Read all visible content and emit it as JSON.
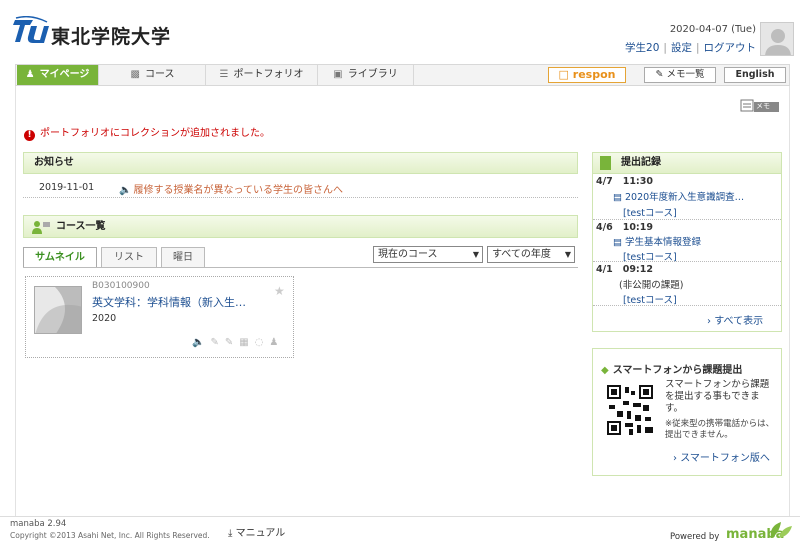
{
  "header": {
    "university_name": "東北学院大学",
    "date": "2020-04-07 (Tue)",
    "user": "学生20",
    "settings": "設定",
    "logout": "ログアウト",
    "separator": "|"
  },
  "nav": {
    "tabs": [
      {
        "label": "マイページ",
        "icon": "person-icon",
        "active": true
      },
      {
        "label": "コース",
        "icon": "class-icon"
      },
      {
        "label": "ポートフォリオ",
        "icon": "portfolio-icon"
      },
      {
        "label": "ライブラリ",
        "icon": "library-icon"
      }
    ],
    "respon": "respon",
    "memo_list": "メモ一覧",
    "english": "English"
  },
  "memo_label": "メモ",
  "alert": "ポートフォリオにコレクションが追加されました。",
  "news": {
    "heading": "お知らせ",
    "items": [
      {
        "date": "2019-11-01",
        "title": "履修する授業名が異なっている学生の皆さんへ"
      }
    ]
  },
  "courses": {
    "heading": "コース一覧",
    "view_tabs": [
      "サムネイル",
      "リスト",
      "曜日"
    ],
    "filter_course": "現在のコース",
    "filter_year": "すべての年度",
    "items": [
      {
        "code": "B030100900",
        "title": "英文学科：学科情報（新入生…",
        "year": "2020"
      }
    ]
  },
  "submissions": {
    "heading": "提出記録",
    "items": [
      {
        "date": "4/7",
        "time": "11:30",
        "title": "2020年度新入生意識調査…",
        "course": "[testコース]"
      },
      {
        "date": "4/6",
        "time": "10:19",
        "title": "学生基本情報登録",
        "course": "[testコース]"
      },
      {
        "date": "4/1",
        "time": "09:12",
        "title": "(非公開の課題)",
        "course": "[testコース]"
      }
    ],
    "more": "すべて表示"
  },
  "smartphone": {
    "heading": "スマートフォンから課題提出",
    "desc": "スマートフォンから課題を提出する事もできます。",
    "note": "※従来型の携帯電話からは、提出できません。",
    "link": "スマートフォン版へ"
  },
  "footer": {
    "version": "manaba 2.94",
    "copyright": "Copyright ©2013 Asahi Net, Inc. All Rights Reserved.",
    "manual": "マニュアル",
    "powered": "Powered by",
    "brand": "manaba"
  },
  "colors": {
    "accent": "#79b43a",
    "link": "#1d4f91",
    "alert": "#cc0000",
    "respon": "#e8901a"
  }
}
